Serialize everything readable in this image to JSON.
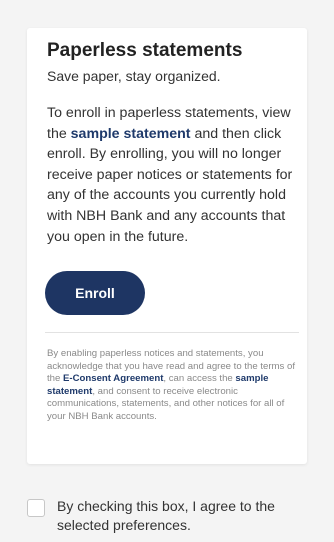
{
  "card": {
    "title": "Paperless statements",
    "subtitle": "Save paper, stay organized.",
    "body": {
      "before_link": "To enroll in paperless statements, view the ",
      "link": "sample statement",
      "after_link": " and then click enroll. By enrolling, you will no longer receive paper notices or statements for any of the accounts you currently hold with NBH Bank and any accounts that you open in the future."
    },
    "enroll_label": "Enroll",
    "legal": {
      "part1": "By enabling paperless notices and statements, you acknowledge that you have read and agree to the terms of the ",
      "link1": "E-Consent Agreement",
      "part2": ", can access the ",
      "link2": "sample statement",
      "part3": ", and consent to receive electronic communications, statements, and other notices for all of your NBH Bank accounts."
    }
  },
  "consent": {
    "checked": false,
    "label": "By checking this box, I agree to the selected preferences."
  },
  "colors": {
    "primary": "#1e3563",
    "link": "#1f3a6b",
    "background": "#f4f4f4",
    "card": "#ffffff"
  }
}
